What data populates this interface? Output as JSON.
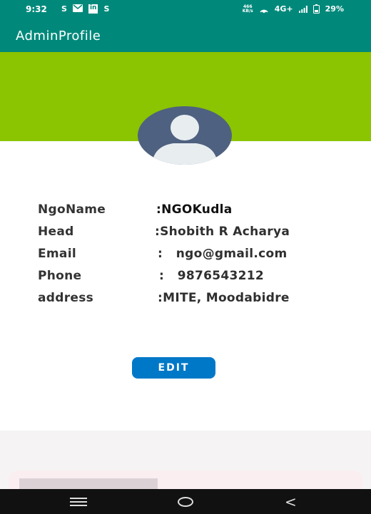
{
  "status_bar": {
    "time": "9:32",
    "left_icons": [
      "S",
      "mail-icon",
      "in",
      "S"
    ],
    "network_speed_top": "466",
    "network_speed_unit": "KB/s",
    "network_type": "4G+",
    "battery": "29%"
  },
  "app_bar": {
    "title": "AdminProfile"
  },
  "colors": {
    "app_bar": "#00897b",
    "hero": "#8bc400",
    "edit_button": "#0078c8"
  },
  "profile": {
    "rows": [
      {
        "label": "NgoName",
        "value": ":NGOKudla"
      },
      {
        "label": "Head",
        "value": ":Shobith R Acharya"
      },
      {
        "label": "Email",
        "value": ":   ngo@gmail.com"
      },
      {
        "label": "Phone",
        "value": ":   9876543212"
      },
      {
        "label": "address",
        "value": ":MITE, Moodabidre"
      }
    ]
  },
  "edit_button": {
    "label": "EDIT"
  }
}
